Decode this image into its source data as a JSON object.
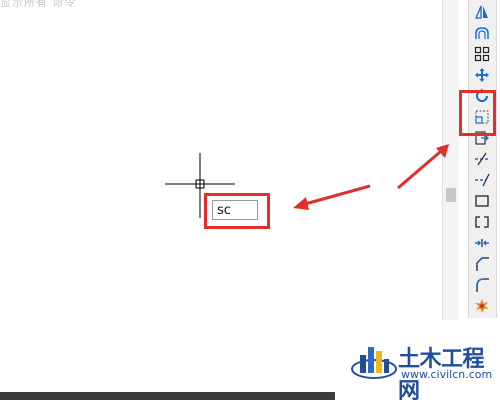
{
  "header": {
    "faded_text": "显示所有  命令"
  },
  "command_input": {
    "value": "sc"
  },
  "toolbar": {
    "tools": [
      {
        "icon": "mirror-icon"
      },
      {
        "icon": "offset-icon"
      },
      {
        "icon": "array-icon"
      },
      {
        "icon": "move-icon"
      },
      {
        "icon": "rotate-icon"
      },
      {
        "icon": "scale-icon"
      },
      {
        "icon": "stretch-icon"
      },
      {
        "icon": "trim-icon"
      },
      {
        "icon": "extend-icon"
      },
      {
        "icon": "break-at-point-icon"
      },
      {
        "icon": "break-icon"
      },
      {
        "icon": "join-icon"
      },
      {
        "icon": "chamfer-icon"
      },
      {
        "icon": "fillet-icon"
      },
      {
        "icon": "explode-icon"
      }
    ]
  },
  "watermark": {
    "title": "土木工程网",
    "url": "www.civilcn.com"
  },
  "colors": {
    "highlight": "#e0302c",
    "toolbar_icon": "#1a6ccf",
    "watermark": "#1f4f9c"
  }
}
